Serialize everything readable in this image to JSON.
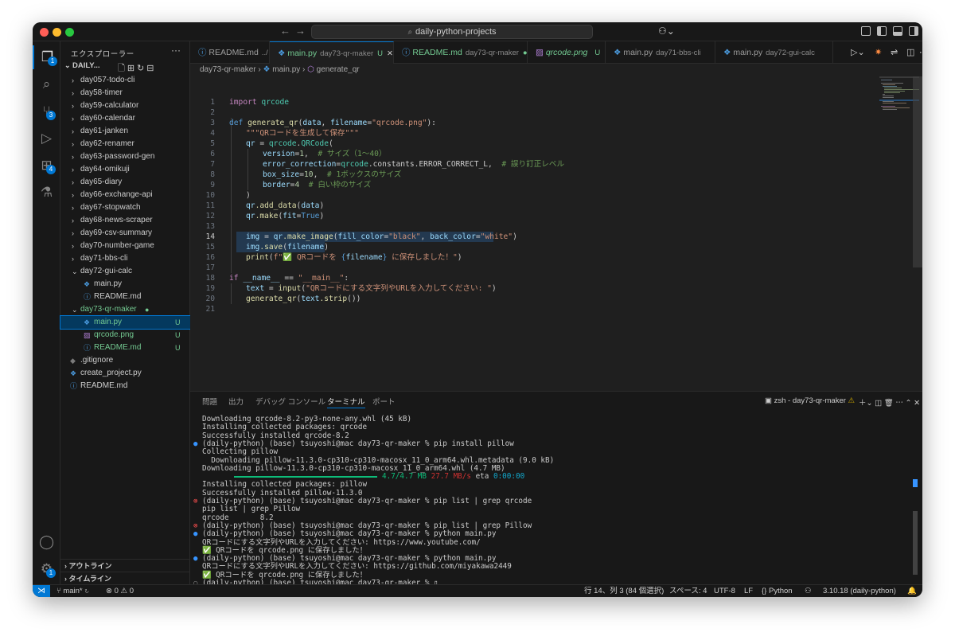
{
  "titlebar": {
    "search_text": "daily-python-projects",
    "back_icon": "arrow-left-icon",
    "forward_icon": "arrow-right-icon"
  },
  "activity": {
    "explorer_badge": "1",
    "scm_badge": "3",
    "extensions_badge": "4",
    "settings_badge": "1"
  },
  "sidebar": {
    "header": "エクスプローラー",
    "project": "DAILY...",
    "items": [
      {
        "label": "day057-todo-cli",
        "type": "folder"
      },
      {
        "label": "day58-timer",
        "type": "folder"
      },
      {
        "label": "day59-calculator",
        "type": "folder"
      },
      {
        "label": "day60-calendar",
        "type": "folder"
      },
      {
        "label": "day61-janken",
        "type": "folder"
      },
      {
        "label": "day62-renamer",
        "type": "folder"
      },
      {
        "label": "day63-password-gen",
        "type": "folder"
      },
      {
        "label": "day64-omikuji",
        "type": "folder"
      },
      {
        "label": "day65-diary",
        "type": "folder"
      },
      {
        "label": "day66-exchange-api",
        "type": "folder"
      },
      {
        "label": "day67-stopwatch",
        "type": "folder"
      },
      {
        "label": "day68-news-scraper",
        "type": "folder"
      },
      {
        "label": "day69-csv-summary",
        "type": "folder"
      },
      {
        "label": "day70-number-game",
        "type": "folder"
      },
      {
        "label": "day71-bbs-cli",
        "type": "folder"
      },
      {
        "label": "day72-gui-calc",
        "type": "folder-open"
      },
      {
        "label": "main.py",
        "type": "py",
        "indent": 1
      },
      {
        "label": "README.md",
        "type": "md",
        "indent": 1
      },
      {
        "label": "day73-qr-maker",
        "type": "folder-open",
        "status": "●"
      },
      {
        "label": "main.py",
        "type": "py",
        "indent": 1,
        "status": "U",
        "selected": true
      },
      {
        "label": "qrcode.png",
        "type": "png",
        "indent": 1,
        "status": "U"
      },
      {
        "label": "README.md",
        "type": "md",
        "indent": 1,
        "status": "U"
      },
      {
        "label": ".gitignore",
        "type": "git"
      },
      {
        "label": "create_project.py",
        "type": "py"
      },
      {
        "label": "README.md",
        "type": "md"
      }
    ],
    "outline": "アウトライン",
    "timeline": "タイムライン"
  },
  "tabs": [
    {
      "label": "README.md",
      "sub": "../",
      "status": ""
    },
    {
      "label": "main.py",
      "sub": "day73-qr-maker",
      "status": "U",
      "active": true
    },
    {
      "label": "README.md",
      "sub": "day73-qr-maker",
      "status": "●"
    },
    {
      "label": "qrcode.png",
      "sub": "",
      "status": "U"
    },
    {
      "label": "main.py",
      "sub": "day71-bbs-cli",
      "status": ""
    },
    {
      "label": "main.py",
      "sub": "day72-gui-calc",
      "status": ""
    }
  ],
  "breadcrumb": {
    "folder": "day73-qr-maker",
    "file": "main.py",
    "symbol": "generate_qr"
  },
  "code_lines": [
    "1",
    "2",
    "3",
    "4",
    "5",
    "6",
    "7",
    "8",
    "9",
    "10",
    "11",
    "12",
    "13",
    "14",
    "15",
    "16",
    "17",
    "18",
    "19",
    "20",
    "21"
  ],
  "code": {
    "l1_kw": "import",
    "l1_mod": " qrcode",
    "l3_def": "def",
    "l3_fn": " generate_qr",
    "l3_a": "(",
    "l3_p1": "data",
    "l3_b": ", ",
    "l3_p2": "filename",
    "l3_c": "=",
    "l3_s": "\"qrcode.png\"",
    "l3_d": "):",
    "l4": "\"\"\"QRコードを生成して保存\"\"\"",
    "l5_v": "qr",
    "l5_e": " = ",
    "l5_m": "qrcode",
    "l5_dot": ".",
    "l5_c": "QRCode",
    "l5_p": "(",
    "l6_v": "version",
    "l6_e": "=",
    "l6_n": "1",
    "l6_x": ",  ",
    "l6_cm": "# サイズ（1〜40）",
    "l7_v": "error_correction",
    "l7_e": "=",
    "l7_m": "qrcode",
    "l7_r": ".constants.ERROR_CORRECT_L",
    "l7_x": ",  ",
    "l7_cm": "# 誤り訂正レベル",
    "l8_v": "box_size",
    "l8_e": "=",
    "l8_n": "10",
    "l8_x": ",  ",
    "l8_cm": "# 1ボックスのサイズ",
    "l9_v": "border",
    "l9_e": "=",
    "l9_n": "4",
    "l9_x": "  ",
    "l9_cm": "# 白い枠のサイズ",
    "l10": ")",
    "l11_v": "qr",
    "l11_f": ".add_data",
    "l11_a": "(",
    "l11_p": "data",
    "l11_b": ")",
    "l12_v": "qr",
    "l12_f": ".make",
    "l12_a": "(",
    "l12_p": "fit",
    "l12_e": "=",
    "l12_t": "True",
    "l12_b": ")",
    "l14_v": "img",
    "l14_e": " = ",
    "l14_q": "qr",
    "l14_f": ".make_image",
    "l14_a": "(",
    "l14_p1": "fill_color",
    "l14_e2": "=",
    "l14_s1": "\"black\"",
    "l14_c": ", ",
    "l14_p2": "back_color",
    "l14_e3": "=",
    "l14_s2": "\"white\"",
    "l14_b": ")",
    "l15_v": "img",
    "l15_f": ".save",
    "l15_a": "(",
    "l15_p": "filename",
    "l15_b": ")",
    "l16_f": "print",
    "l16_a": "(",
    "l16_s1": "f\"✅ QRコードを ",
    "l16_br1": "{",
    "l16_v": "filename",
    "l16_br2": "}",
    "l16_s2": " に保存しました！\"",
    "l16_b": ")",
    "l18_if": "if",
    "l18_v": " __name__",
    "l18_e": " == ",
    "l18_s": "\"__main__\"",
    "l18_c": ":",
    "l19_v": "text",
    "l19_e": " = ",
    "l19_f": "input",
    "l19_a": "(",
    "l19_s": "\"QRコードにする文字列やURLを入力してください: \"",
    "l19_b": ")",
    "l20_f": "generate_qr",
    "l20_a": "(",
    "l20_v": "text",
    "l20_m": ".strip",
    "l20_b": "())"
  },
  "panel": {
    "tabs": [
      "問題",
      "出力",
      "デバッグ コンソール",
      "ターミナル",
      "ポート"
    ],
    "active_tab": "ターミナル",
    "terminal_name": "zsh - day73-qr-maker"
  },
  "terminal": {
    "lines": [
      {
        "text": "Downloading qrcode-8.2-py3-none-any.whl (45 kB)",
        "dot": ""
      },
      {
        "text": "Installing collected packages: qrcode",
        "dot": ""
      },
      {
        "text": "Successfully installed qrcode-8.2",
        "dot": ""
      },
      {
        "text": "(daily-python) (base) tsuyoshi@mac day73-qr-maker % pip install pillow",
        "dot": "b"
      },
      {
        "text": "Collecting pillow",
        "dot": ""
      },
      {
        "text": "  Downloading pillow-11.3.0-cp310-cp310-macosx_11_0_arm64.whl.metadata (9.0 kB)",
        "dot": ""
      },
      {
        "text": "Downloading pillow-11.3.0-cp310-cp310-macosx_11_0_arm64.whl (4.7 MB)",
        "dot": ""
      },
      {
        "text": "PROGRESS",
        "dot": ""
      },
      {
        "text": "Installing collected packages: pillow",
        "dot": ""
      },
      {
        "text": "Successfully installed pillow-11.3.0",
        "dot": ""
      },
      {
        "text": "(daily-python) (base) tsuyoshi@mac day73-qr-maker % pip list | grep qrcode",
        "dot": "r"
      },
      {
        "text": "pip list | grep Pillow",
        "dot": ""
      },
      {
        "text": "qrcode       8.2",
        "dot": ""
      },
      {
        "text": "(daily-python) (base) tsuyoshi@mac day73-qr-maker % pip list | grep Pillow",
        "dot": "r"
      },
      {
        "text": "(daily-python) (base) tsuyoshi@mac day73-qr-maker % python main.py",
        "dot": "b"
      },
      {
        "text": "QRコードにする文字列やURLを入力してください: https://www.youtube.com/",
        "dot": ""
      },
      {
        "text": "✅ QRコードを qrcode.png に保存しました！",
        "dot": ""
      },
      {
        "text": "(daily-python) (base) tsuyoshi@mac day73-qr-maker % python main.py",
        "dot": "b"
      },
      {
        "text": "QRコードにする文字列やURLを入力してください: https://github.com/miyakawa2449",
        "dot": ""
      },
      {
        "text": "✅ QRコードを qrcode.png に保存しました！",
        "dot": ""
      },
      {
        "text": "(daily-python) (base) tsuyoshi@mac day73-qr-maker % ▯",
        "dot": "g"
      }
    ],
    "progress_size": "4.7/4.7 MB",
    "progress_speed": "27.7 MB/s",
    "progress_eta_label": "eta",
    "progress_eta": "0:00:00",
    "progress_fraction": 1.0
  },
  "status": {
    "branch": "main*",
    "errors": "0",
    "warnings": "0",
    "position": "行 14、列 3 (84 個選択)",
    "spaces": "スペース: 4",
    "encoding": "UTF-8",
    "eol": "LF",
    "language": "Python",
    "python_version": "3.10.18 (daily-python)"
  },
  "colors": {
    "accent": "#0078d4",
    "untracked": "#73c991",
    "editor_bg": "#1f1f1f",
    "sidebar_bg": "#181818"
  }
}
